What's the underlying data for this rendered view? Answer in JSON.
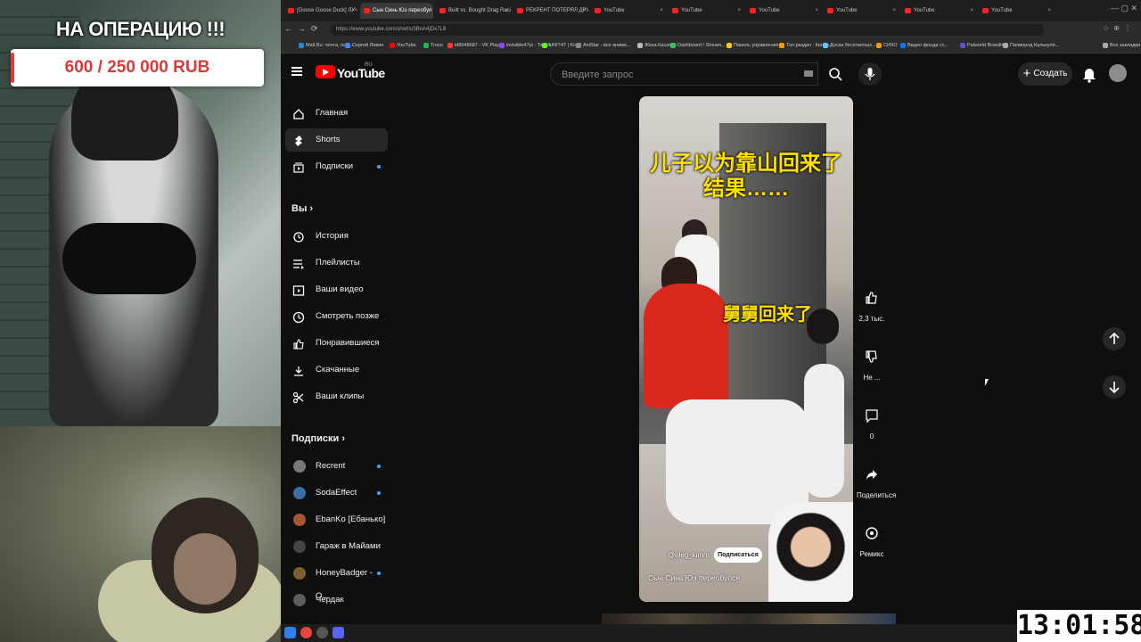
{
  "overlay": {
    "goal_title": "НА ОПЕРАЦИЮ !!!",
    "goal_text": "600 / 250 000 RUB"
  },
  "tabs": [
    {
      "label": "[Goose Goose Duck] ЛУЧШ",
      "active": false
    },
    {
      "label": "Сын Синь Юэ переобул",
      "active": true
    },
    {
      "label": "Built vs. Bought Drag Racing",
      "active": false
    },
    {
      "label": "РЕКРЕНТ ПОТЕРЯЛ ДРУГА -",
      "active": false
    },
    {
      "label": "YouTube",
      "active": false
    },
    {
      "label": "YouTube",
      "active": false
    },
    {
      "label": "YouTube",
      "active": false
    },
    {
      "label": "YouTube",
      "active": false
    },
    {
      "label": "YouTube",
      "active": false
    },
    {
      "label": "YouTube",
      "active": false
    }
  ],
  "address_bar": {
    "url": "https://www.youtube.com/shorts/3BnA4jDx7L8"
  },
  "bookmarks": [
    {
      "label": "Mail.Ru: почта, пои...",
      "color": "#1e88e5"
    },
    {
      "label": "Сергей Ловин",
      "color": "#4285f4"
    },
    {
      "label": "YouTube",
      "color": "#ff0000"
    },
    {
      "label": "Trovo",
      "color": "#1db954"
    },
    {
      "label": "id8048687 - VK Play...",
      "color": "#ff3b30"
    },
    {
      "label": "invisible47yt - Twitch",
      "color": "#9146ff"
    },
    {
      "label": "UNIT47 | Kick",
      "color": "#53fc18"
    },
    {
      "label": "AniStar - все аниме...",
      "color": "#888888"
    },
    {
      "label": "Жека Касатон",
      "color": "#bbbbbb"
    },
    {
      "label": "Dashboard / Stream...",
      "color": "#34c759"
    },
    {
      "label": "Панель управления",
      "color": "#ffcc00"
    },
    {
      "label": "Топ раздач : Кинов...",
      "color": "#ff9500"
    },
    {
      "label": "Доска бесплатных...",
      "color": "#5ac8fa"
    },
    {
      "label": "СИХО",
      "color": "#ff9500"
    },
    {
      "label": "Видео фонда ст...",
      "color": "#007aff"
    },
    {
      "label": "Palworld Breeding...",
      "color": "#5856d6"
    },
    {
      "label": "Палворлд Калькуля...",
      "color": "#aaaaaa"
    },
    {
      "label": "Все закладки",
      "color": "#aaaaaa"
    }
  ],
  "youtube": {
    "logo_text": "YouTube",
    "region": "RU",
    "search_placeholder": "Введите запрос",
    "create_label": "Создать"
  },
  "sidebar": {
    "main": [
      {
        "label": "Главная",
        "icon": "home-icon"
      },
      {
        "label": "Shorts",
        "icon": "shorts-icon"
      },
      {
        "label": "Подписки",
        "icon": "subscriptions-icon"
      }
    ],
    "you_heading": "Вы",
    "you": [
      {
        "label": "История",
        "icon": "history-icon"
      },
      {
        "label": "Плейлисты",
        "icon": "playlists-icon"
      },
      {
        "label": "Ваши видео",
        "icon": "your-videos-icon"
      },
      {
        "label": "Смотреть позже",
        "icon": "watch-later-icon"
      },
      {
        "label": "Понравившиеся",
        "icon": "liked-icon"
      },
      {
        "label": "Скачанные",
        "icon": "downloads-icon"
      },
      {
        "label": "Ваши клипы",
        "icon": "clips-icon"
      }
    ],
    "subs_heading": "Подписки",
    "subs": [
      {
        "label": "Recrent",
        "color": "#777777"
      },
      {
        "label": "SodaEffect",
        "color": "#3b6ea5"
      },
      {
        "label": "EbanKo [Ебанько]",
        "color": "#a5562f"
      },
      {
        "label": "Гараж в Майами",
        "color": "#444444"
      },
      {
        "label": "HoneyBadger - O...",
        "color": "#7b5e36"
      },
      {
        "label": "Чердак",
        "color": "#5d5d5d"
      }
    ]
  },
  "short": {
    "caption_top": "儿子以为靠山回来了\n结果……",
    "caption_mid": "舅舅回来了",
    "handle": "@oleg_kimm",
    "subscribe_label": "Подписаться",
    "title": "Сын Синь Юэ переобулся"
  },
  "actions": [
    {
      "label": "2,3 тыс.",
      "icon": "like-icon"
    },
    {
      "label": "Не ...",
      "icon": "dislike-icon"
    },
    {
      "label": "0",
      "icon": "comment-icon"
    },
    {
      "label": "Поделиться",
      "icon": "share-icon"
    },
    {
      "label": "Ремикс",
      "icon": "remix-icon"
    }
  ],
  "clock": "13:01:58"
}
